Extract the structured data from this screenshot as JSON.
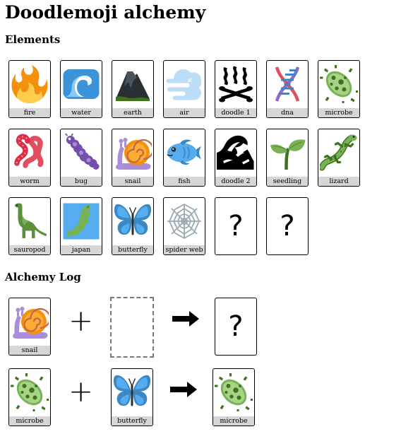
{
  "title": "Doodlemoji alchemy",
  "elements_heading": "Elements",
  "log_heading": "Alchemy Log",
  "elements": [
    {
      "key": "fire",
      "label": "fire"
    },
    {
      "key": "water",
      "label": "water"
    },
    {
      "key": "earth",
      "label": "earth"
    },
    {
      "key": "air",
      "label": "air"
    },
    {
      "key": "doodle1",
      "label": "doodle 1"
    },
    {
      "key": "dna",
      "label": "dna"
    },
    {
      "key": "microbe",
      "label": "microbe"
    },
    {
      "key": "worm",
      "label": "worm"
    },
    {
      "key": "bug",
      "label": "bug"
    },
    {
      "key": "snail",
      "label": "snail"
    },
    {
      "key": "fish",
      "label": "fish"
    },
    {
      "key": "doodle2",
      "label": "doodle 2"
    },
    {
      "key": "seedling",
      "label": "seedling"
    },
    {
      "key": "lizard",
      "label": "lizard"
    },
    {
      "key": "sauropod",
      "label": "sauropod"
    },
    {
      "key": "japan",
      "label": "japan"
    },
    {
      "key": "butterfly",
      "label": "butterfly"
    },
    {
      "key": "spiderweb",
      "label": "spider web"
    },
    {
      "key": "unknown",
      "label": "?"
    },
    {
      "key": "unknown",
      "label": "?"
    }
  ],
  "log": [
    {
      "first": {
        "key": "snail",
        "label": "snail"
      },
      "operator": "+",
      "second": null,
      "result": {
        "key": "unknown",
        "label": "?"
      }
    },
    {
      "first": {
        "key": "microbe",
        "label": "microbe"
      },
      "operator": "+",
      "second": {
        "key": "butterfly",
        "label": "butterfly"
      },
      "result": {
        "key": "microbe",
        "label": "microbe"
      }
    }
  ]
}
